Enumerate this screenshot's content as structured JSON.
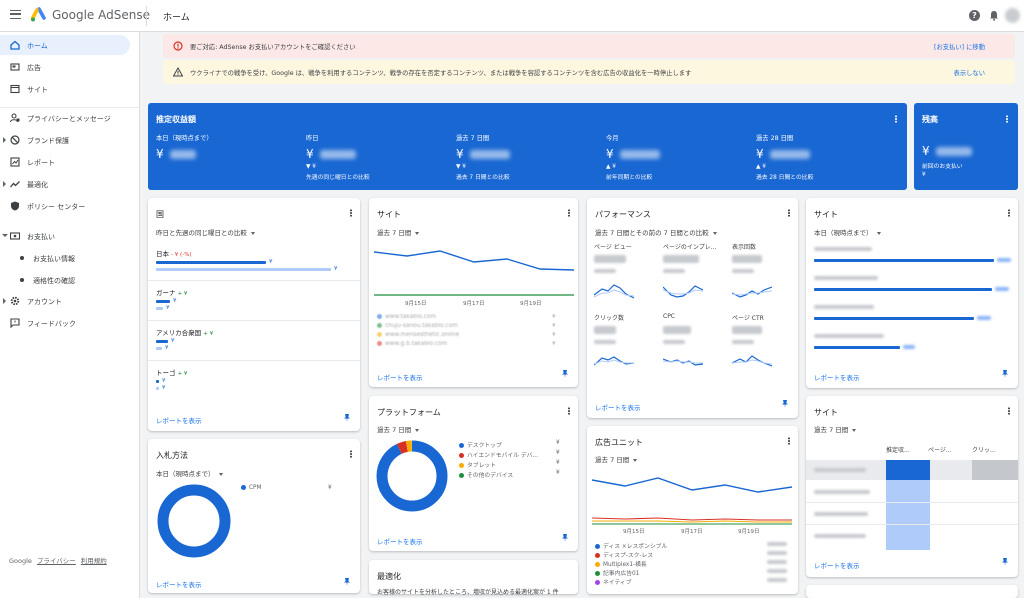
{
  "app": {
    "brand_google": "Google",
    "brand_product": "AdSense",
    "page_title": "ホーム"
  },
  "sidebar": {
    "items": [
      {
        "label": "ホーム",
        "icon": "home-icon"
      },
      {
        "label": "広告",
        "icon": "ads-icon"
      },
      {
        "label": "サイト",
        "icon": "sites-icon"
      },
      {
        "label": "プライバシーとメッセージ",
        "icon": "privacy-icon"
      },
      {
        "label": "ブランド保護",
        "icon": "block-icon"
      },
      {
        "label": "レポート",
        "icon": "report-icon"
      },
      {
        "label": "最適化",
        "icon": "trend-icon"
      },
      {
        "label": "ポリシー センター",
        "icon": "shield-icon"
      },
      {
        "label": "お支払い",
        "icon": "payments-icon"
      },
      {
        "label": "お支払い情報",
        "icon": ""
      },
      {
        "label": "適格性の確認",
        "icon": ""
      },
      {
        "label": "アカウント",
        "icon": "gear-icon"
      },
      {
        "label": "フィードバック",
        "icon": "feedback-icon"
      }
    ],
    "footer": {
      "google": "Google",
      "privacy": "プライバシー",
      "terms": "利用規約"
    }
  },
  "banners": [
    {
      "text": "要ご対応: AdSense お支払いアカウントをご確認ください",
      "action": "[お支払い] に移動",
      "color": "#fce8e6"
    },
    {
      "text": "ウクライナでの戦争を受け、Google は、戦争を利用するコンテンツ、戦争の存在を否定するコンテンツ、または戦争を容認するコンテンツを含む広告の収益化を一時停止します",
      "action": "表示しない",
      "color": "#fef7e0"
    }
  ],
  "earnings": {
    "title": "推定収益額",
    "currency": "¥",
    "columns": [
      {
        "label": "本日（現時点まで）",
        "compare": "",
        "compare2": ""
      },
      {
        "label": "昨日",
        "compare": "▼ ¥",
        "compare2": "先週の同じ曜日との比較"
      },
      {
        "label": "過去 7 日間",
        "compare": "▼ ¥",
        "compare2": "過去 7 日間との比較"
      },
      {
        "label": "今月",
        "compare": "▲ ¥",
        "compare2": "前年同期との比較"
      },
      {
        "label": "過去 28 日間",
        "compare": "▲ ¥",
        "compare2": "過去 28 日間との比較"
      }
    ]
  },
  "balance": {
    "title": "残高",
    "currency": "¥",
    "sub": "前回のお支払い",
    "sub2": "¥"
  },
  "country_card": {
    "title": "国",
    "filter": "昨日と先週の同じ曜日との比較",
    "rows": [
      {
        "name": "日本",
        "change": "- ¥ (-%)",
        "yen": "¥",
        "yen2": "¥"
      },
      {
        "name": "ガーナ",
        "change": "+ ¥",
        "yen": "¥",
        "yen2": "¥"
      },
      {
        "name": "アメリカ合衆国",
        "change": "+ ¥",
        "yen": "¥",
        "yen2": "¥"
      },
      {
        "name": "トーゴ",
        "change": "+ ¥",
        "yen": "¥",
        "yen2": "¥"
      }
    ],
    "link": "レポートを表示"
  },
  "bidding_card": {
    "title": "入札方法",
    "filter": "本日（現時点まで）",
    "legend": "CPM",
    "value": "¥",
    "link": "レポートを表示"
  },
  "site_card": {
    "title": "サイト",
    "filter": "過去 7 日間",
    "ticks": [
      "9月15日",
      "9月17日",
      "9月19日"
    ],
    "legend": [
      {
        "name": "www.takablo.com",
        "color": "#1967d2",
        "value": "¥"
      },
      {
        "name": "chuju-sanou.takablo.com",
        "color": "#1e8e3e",
        "value": "¥"
      },
      {
        "name": "www.mensesthetic.online",
        "color": "#f9ab00",
        "value": "¥"
      },
      {
        "name": "www.g.b.takablo.com",
        "color": "#d93025",
        "value": "¥"
      }
    ],
    "link": "レポートを表示"
  },
  "platform_card": {
    "title": "プラットフォーム",
    "filter": "過去 7 日間",
    "legend": [
      {
        "name": "デスクトップ",
        "color": "#1967d2",
        "value": "¥"
      },
      {
        "name": "ハイエンドモバイル デバ...",
        "color": "#d93025",
        "value": "¥"
      },
      {
        "name": "タブレット",
        "color": "#f9ab00",
        "value": "¥"
      },
      {
        "name": "その他のデバイス",
        "color": "#1e8e3e",
        "value": "¥"
      }
    ],
    "link": "レポートを表示"
  },
  "optimize_card": {
    "title": "最適化",
    "text": "お客様のサイトを分析したところ、増収が見込める最適化案が 1 件"
  },
  "performance_card": {
    "title": "パフォーマンス",
    "filter": "過去 7 日間とその前の 7 日間との比較",
    "metrics": [
      "ページ ビュー",
      "ページのインプレ...",
      "表示回数",
      "クリック数",
      "CPC",
      "ページ CTR"
    ],
    "link": "レポートを表示"
  },
  "adunit_card": {
    "title": "広告ユニット",
    "filter": "過去 7 日間",
    "ticks": [
      "9月15日",
      "9月17日",
      "9月19日"
    ],
    "legend": [
      {
        "name": "ディス ×レスポンシブル",
        "color": "#1967d2"
      },
      {
        "name": "ディスプ-スク-レス",
        "color": "#d93025"
      },
      {
        "name": "Multiplex1-横長",
        "color": "#f9ab00"
      },
      {
        "name": "記事内広告01",
        "color": "#1e8e3e"
      },
      {
        "name": "ネイティブ",
        "color": "#a142f4"
      }
    ]
  },
  "site_card2": {
    "title": "サイト",
    "filter": "本日（現時点まで）",
    "link": "レポートを表示"
  },
  "site_table_card": {
    "title": "サイト",
    "filter": "過去 7 日間",
    "headers": [
      "推定収...",
      "ページ...",
      "クリッ..."
    ],
    "link": "レポートを表示"
  },
  "colors": {
    "primary": "#1967d2",
    "link": "#1a73e8"
  }
}
